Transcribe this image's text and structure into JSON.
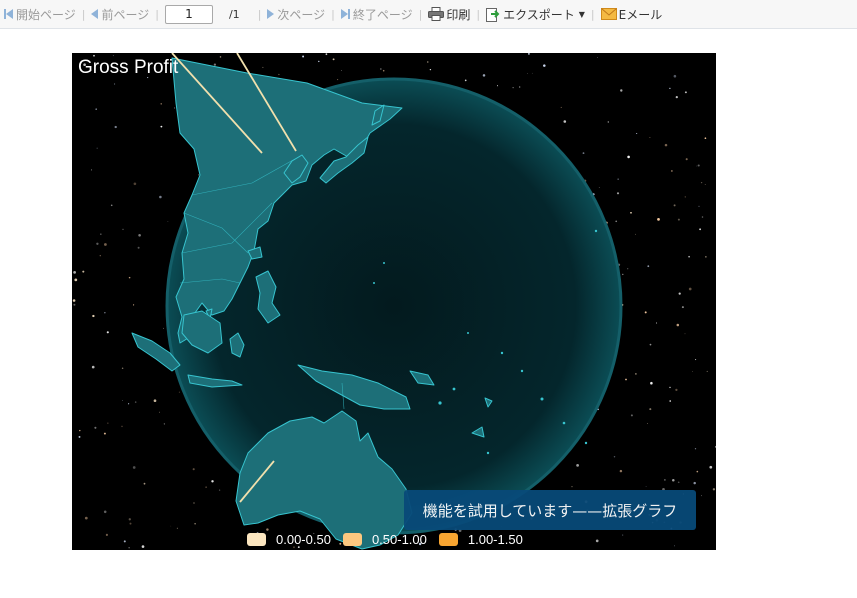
{
  "toolbar": {
    "first_page": "開始ページ",
    "prev_page": "前ページ",
    "page_value": "1",
    "page_total": "/1",
    "next_page": "次ページ",
    "last_page": "終了ページ",
    "print": "印刷",
    "export": "エクスポート",
    "email": "Eメール"
  },
  "chart": {
    "title": "Gross Profit",
    "trial_banner": "機能を試用しています——拡張グラフ",
    "legend": [
      {
        "label": "0.00-0.50",
        "color": "#fce6c0"
      },
      {
        "label": "0.50-1.00",
        "color": "#fcc77f"
      },
      {
        "label": "1.00-1.50",
        "color": "#f8a531"
      }
    ]
  }
}
